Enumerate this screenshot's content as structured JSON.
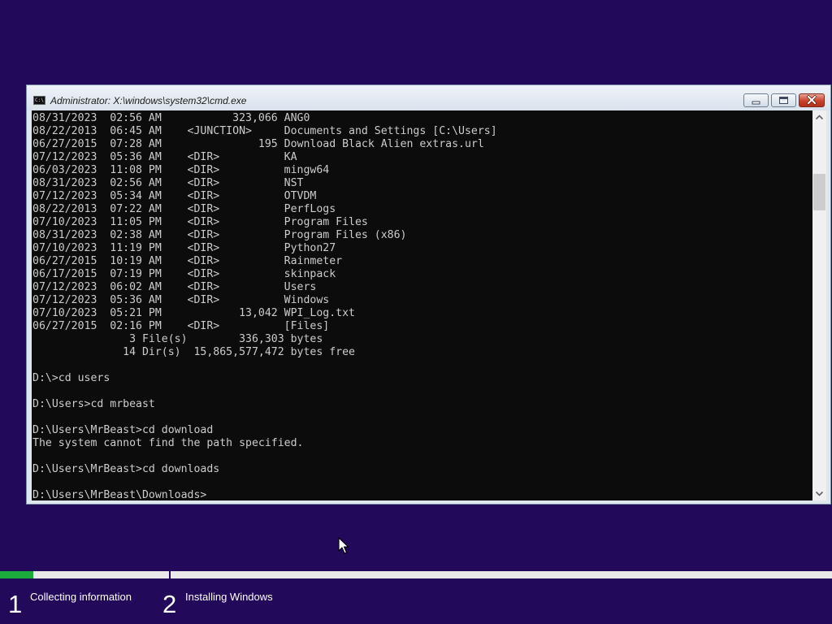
{
  "window": {
    "title": "Administrator: X:\\windows\\system32\\cmd.exe",
    "icon_text": "C:\\"
  },
  "console": {
    "lines": [
      "08/31/2023  02:56 AM           323,066 ANG0",
      "08/22/2013  06:45 AM    <JUNCTION>     Documents and Settings [C:\\Users]",
      "06/27/2015  07:28 AM               195 Download Black Alien extras.url",
      "07/12/2023  05:36 AM    <DIR>          KA",
      "06/03/2023  11:08 PM    <DIR>          mingw64",
      "08/31/2023  02:56 AM    <DIR>          NST",
      "07/12/2023  05:34 AM    <DIR>          OTVDM",
      "08/22/2013  07:22 AM    <DIR>          PerfLogs",
      "07/10/2023  11:05 PM    <DIR>          Program Files",
      "08/31/2023  02:38 AM    <DIR>          Program Files (x86)",
      "07/10/2023  11:19 PM    <DIR>          Python27",
      "06/27/2015  10:19 AM    <DIR>          Rainmeter",
      "06/17/2015  07:19 PM    <DIR>          skinpack",
      "07/12/2023  06:02 AM    <DIR>          Users",
      "07/12/2023  05:36 AM    <DIR>          Windows",
      "07/10/2023  05:21 PM            13,042 WPI_Log.txt",
      "06/27/2015  02:16 PM    <DIR>          [Files]",
      "               3 File(s)        336,303 bytes",
      "              14 Dir(s)  15,865,577,472 bytes free",
      "",
      "D:\\>cd users",
      "",
      "D:\\Users>cd mrbeast",
      "",
      "D:\\Users\\MrBeast>cd download",
      "The system cannot find the path specified.",
      "",
      "D:\\Users\\MrBeast>cd downloads",
      "",
      "D:\\Users\\MrBeast\\Downloads>"
    ]
  },
  "setup": {
    "progress_fraction": 0.04,
    "steps": [
      {
        "number": "1",
        "label": "Collecting information"
      },
      {
        "number": "2",
        "label": "Installing Windows"
      }
    ]
  },
  "colors": {
    "background": "#22095a",
    "progress": "#1aab3c",
    "console_bg": "#0c0c0c",
    "console_fg": "#cccccc"
  },
  "icons": {
    "window_icon": "cmd-icon",
    "minimize": "minimize-icon",
    "maximize": "maximize-icon",
    "close": "close-icon",
    "scroll_up": "chevron-up-icon",
    "scroll_down": "chevron-down-icon",
    "cursor": "mouse-pointer-icon"
  }
}
